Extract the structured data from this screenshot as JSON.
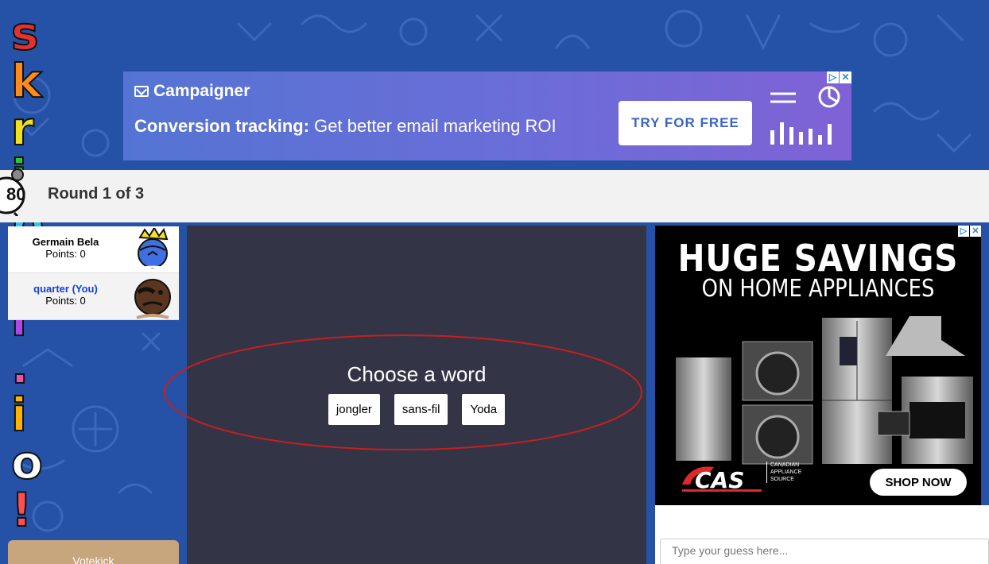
{
  "logo": {
    "text": "skribbl.io!"
  },
  "top_ad": {
    "brand": "Campaigner",
    "tagline_bold": "Conversion tracking:",
    "tagline_rest": " Get better email marketing ROI",
    "cta": "TRY FOR FREE"
  },
  "round": {
    "timer": "80",
    "label": "Round 1 of 3"
  },
  "players": [
    {
      "name": "Germain Bela",
      "points": "Points: 0"
    },
    {
      "name": "quarter (You)",
      "points": "Points: 0"
    }
  ],
  "canvas": {
    "prompt": "Choose a word",
    "words": [
      "jongler",
      "sans-fil",
      "Yoda"
    ]
  },
  "side_ad": {
    "headline": "HUGE SAVINGS",
    "subline": "ON HOME APPLIANCES",
    "logo_lines": [
      "CANADIAN",
      "APPLIANCE",
      "SOURCE"
    ],
    "cta": "SHOP NOW"
  },
  "votekick": {
    "label": "Votekick"
  },
  "chat": {
    "placeholder": "Type your guess here..."
  },
  "colors": {
    "background": "#2552a6",
    "canvas": "#333546",
    "annotation": "#c81e1e",
    "you_name": "#1540d0"
  }
}
